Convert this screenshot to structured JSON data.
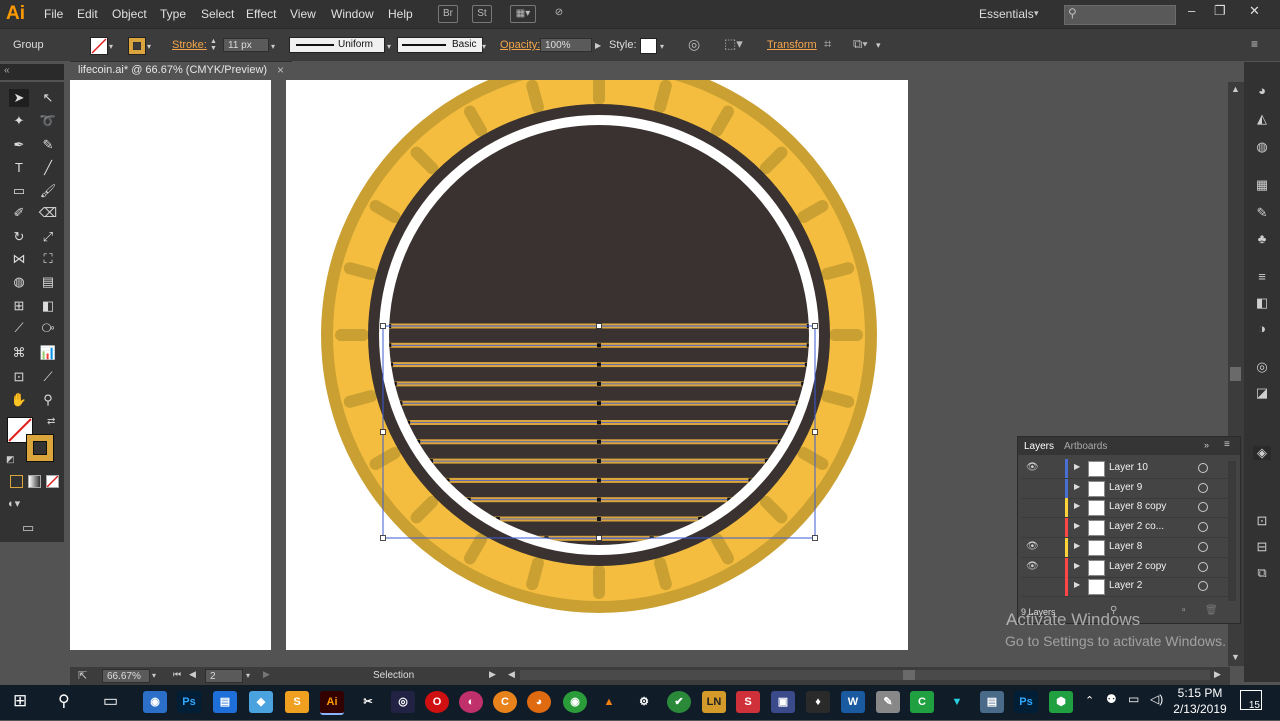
{
  "app": {
    "logo": "Ai"
  },
  "menubar": {
    "items": [
      "File",
      "Edit",
      "Object",
      "Type",
      "Select",
      "Effect",
      "View",
      "Window",
      "Help"
    ],
    "icons": {
      "bridge": "Br",
      "stock": "St"
    },
    "workspace": "Essentials",
    "search_placeholder": ""
  },
  "controlbar": {
    "selection_type": "Group",
    "stroke_label": "Stroke:",
    "stroke_weight": "11 px",
    "profile_label": "Uniform",
    "brush_label": "Basic",
    "opacity_label": "Opacity:",
    "opacity_value": "100%",
    "style_label": "Style:",
    "transform_label": "Transform"
  },
  "document": {
    "tab_title": "lifecoin.ai* @ 66.67% (CMYK/Preview)",
    "close_glyph": "×"
  },
  "layers_panel": {
    "tabs": [
      "Layers",
      "Artboards"
    ],
    "layers": [
      {
        "name": "Layer 10",
        "visible": true,
        "color": "#4a6fd3"
      },
      {
        "name": "Layer 9",
        "visible": false,
        "color": "#4a6fd3"
      },
      {
        "name": "Layer 8 copy",
        "visible": false,
        "color": "#ffd23a"
      },
      {
        "name": "Layer 2 co...",
        "visible": false,
        "color": "#ff4646"
      },
      {
        "name": "Layer 8",
        "visible": true,
        "color": "#ffd23a"
      },
      {
        "name": "Layer 2 copy",
        "visible": true,
        "color": "#ff4646"
      },
      {
        "name": "Layer 2",
        "visible": false,
        "color": "#ff4646"
      }
    ],
    "count_label": "9 Layers"
  },
  "statusbar": {
    "zoom": "66.67%",
    "artboard_number": "2",
    "tool_label": "Selection"
  },
  "watermark": {
    "line1": "Activate Windows",
    "line2": "Go to Settings to activate Windows."
  },
  "taskbar": {
    "time": "5:15 PM",
    "date": "2/13/2019",
    "notification_count": "15",
    "apps": [
      {
        "name": "Ps",
        "color": "#31a8ff"
      },
      {
        "name": "Ai",
        "color": "#ff9a00"
      },
      {
        "name": "LN",
        "color": "#d49b2a"
      },
      {
        "name": "Ps",
        "color": "#31a8ff"
      }
    ]
  },
  "colors": {
    "coin_outer": "#c9a031",
    "coin_ring": "#f4bd3f",
    "coin_dark": "#3a3230",
    "stripe": "#d9a53c",
    "selection_blue": "#3b5bd6",
    "ai_orange": "#ff9a00"
  }
}
